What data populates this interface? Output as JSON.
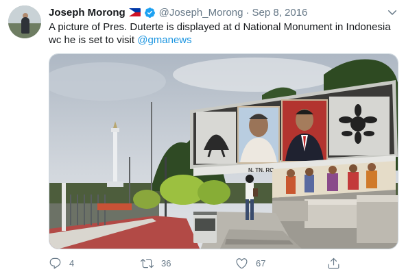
{
  "tweet": {
    "display_name": "Joseph Morong",
    "handle": "@Joseph_Morong",
    "separator": "·",
    "date": "Sep 8, 2016",
    "text_before_mention": "A picture of Pres. Duterte is displayed at d National Monument in Indonesia wc he is set to visit ",
    "mention": "@gmanews",
    "icons": {
      "flag": "philippines-flag-icon",
      "verified": "verified-badge-icon",
      "menu": "chevron-down-icon"
    }
  },
  "actions": {
    "reply_count": "4",
    "retweet_count": "36",
    "like_count": "67"
  },
  "photo": {
    "sign_text": "N. TN. RO"
  },
  "colors": {
    "accent": "#1b95e0",
    "secondary_text": "#657786",
    "primary_text": "#14171a"
  }
}
